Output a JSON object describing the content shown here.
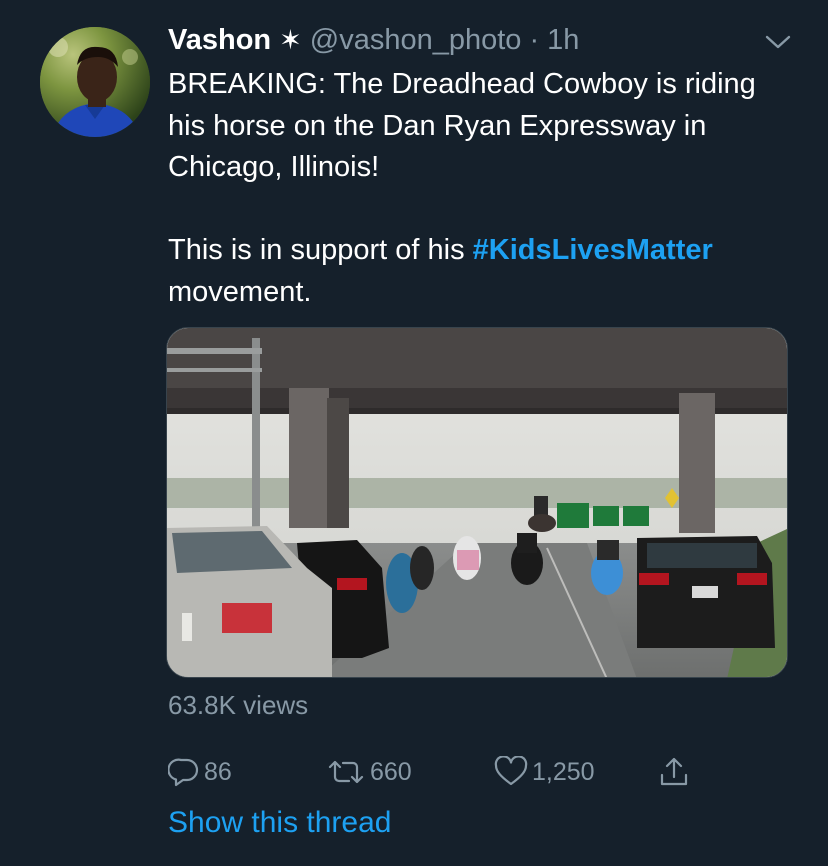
{
  "author": {
    "name": "Vashon",
    "badge": "✶",
    "handle": "@vashon_photo",
    "separator": "·",
    "time": "1h"
  },
  "tweet": {
    "paragraph1": "BREAKING: The Dreadhead Cowboy is riding his horse on the Dan Ryan Expressway in Chicago, Illinois!",
    "paragraph2_prefix": "This is in support of his ",
    "hashtag": "#KidsLivesMatter",
    "paragraph2_suffix": "movement."
  },
  "media": {
    "views": "63.8K views"
  },
  "actions": {
    "reply_count": "86",
    "retweet_count": "660",
    "like_count": "1,250"
  },
  "thread_link": "Show this thread",
  "colors": {
    "background": "#15202b",
    "text": "#ffffff",
    "secondary": "#8899a6",
    "accent": "#1da1f2"
  },
  "icons": [
    "chevron-down-icon",
    "reply-icon",
    "retweet-icon",
    "like-icon",
    "share-icon"
  ]
}
